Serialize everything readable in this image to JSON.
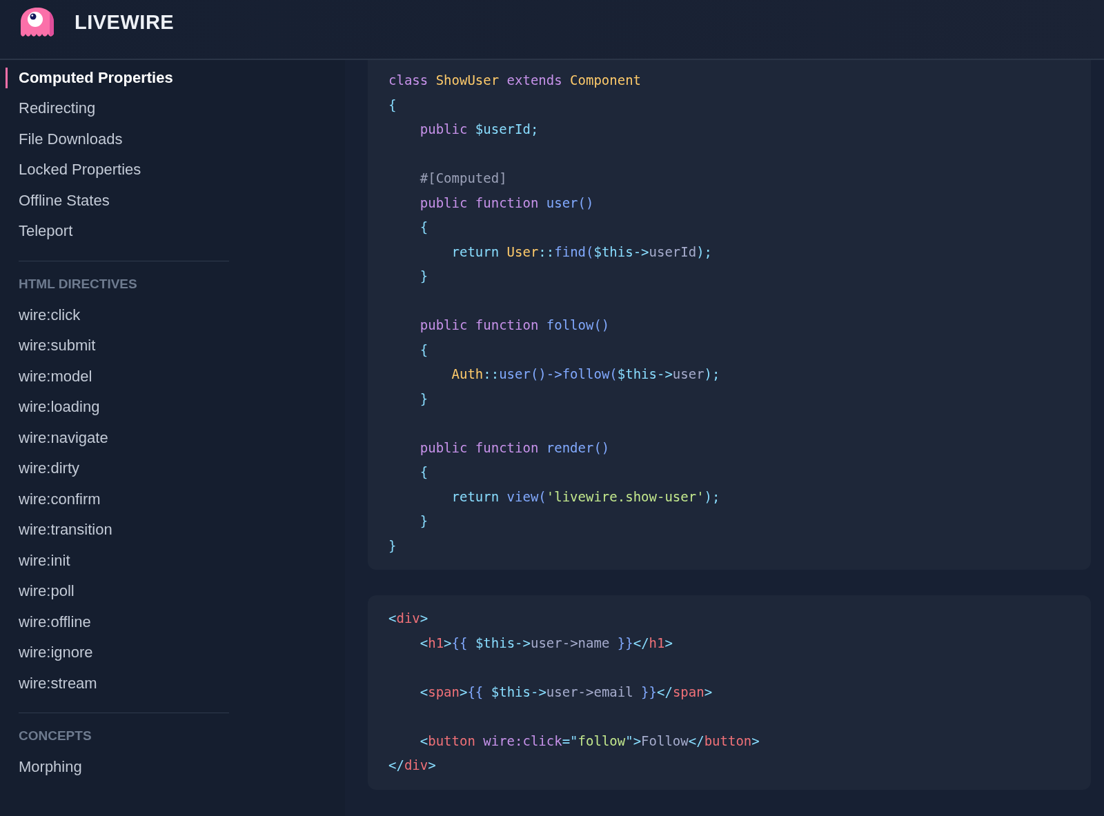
{
  "header": {
    "title": "LIVEWIRE"
  },
  "sidebar": {
    "groups": [
      {
        "items": [
          {
            "label": "Computed Properties",
            "selected": true
          },
          {
            "label": "Redirecting",
            "selected": false
          },
          {
            "label": "File Downloads",
            "selected": false
          },
          {
            "label": "Locked Properties",
            "selected": false
          },
          {
            "label": "Offline States",
            "selected": false
          },
          {
            "label": "Teleport",
            "selected": false
          }
        ]
      },
      {
        "heading": "HTML DIRECTIVES",
        "items": [
          {
            "label": "wire:click",
            "selected": false
          },
          {
            "label": "wire:submit",
            "selected": false
          },
          {
            "label": "wire:model",
            "selected": false
          },
          {
            "label": "wire:loading",
            "selected": false
          },
          {
            "label": "wire:navigate",
            "selected": false
          },
          {
            "label": "wire:dirty",
            "selected": false
          },
          {
            "label": "wire:confirm",
            "selected": false
          },
          {
            "label": "wire:transition",
            "selected": false
          },
          {
            "label": "wire:init",
            "selected": false
          },
          {
            "label": "wire:poll",
            "selected": false
          },
          {
            "label": "wire:offline",
            "selected": false
          },
          {
            "label": "wire:ignore",
            "selected": false
          },
          {
            "label": "wire:stream",
            "selected": false
          }
        ]
      },
      {
        "heading": "CONCEPTS",
        "items": [
          {
            "label": "Morphing",
            "selected": false
          }
        ]
      }
    ]
  },
  "code_blocks": [
    {
      "lines": [
        {
          "kind": "code",
          "tokens": [
            {
              "kind": "keyword",
              "text": "class "
            },
            {
              "kind": "class",
              "text": "ShowUser "
            },
            {
              "kind": "keyword",
              "text": "extends "
            },
            {
              "kind": "class",
              "text": "Component"
            }
          ]
        },
        {
          "kind": "code",
          "tokens": [
            {
              "kind": "punct",
              "text": "{"
            }
          ]
        },
        {
          "kind": "code",
          "tokens": [
            {
              "kind": "keyword",
              "text": "    public "
            },
            {
              "kind": "var",
              "text": "$userId;"
            }
          ]
        },
        {
          "kind": "blank"
        },
        {
          "kind": "code",
          "tokens": [
            {
              "kind": "comment",
              "text": "    #[Computed]"
            }
          ]
        },
        {
          "kind": "code",
          "tokens": [
            {
              "kind": "keyword",
              "text": "    public function "
            },
            {
              "kind": "func",
              "text": "user()"
            }
          ]
        },
        {
          "kind": "code",
          "tokens": [
            {
              "kind": "punct",
              "text": "    {"
            }
          ]
        },
        {
          "kind": "code",
          "tokens": [
            {
              "kind": "punct",
              "text": "        return "
            },
            {
              "kind": "class",
              "text": "User"
            },
            {
              "kind": "punct",
              "text": "::"
            },
            {
              "kind": "func",
              "text": "find("
            },
            {
              "kind": "var",
              "text": "$this->"
            },
            {
              "kind": "plain",
              "text": "userId"
            },
            {
              "kind": "punct",
              "text": ");"
            }
          ]
        },
        {
          "kind": "code",
          "tokens": [
            {
              "kind": "punct",
              "text": "    }"
            }
          ]
        },
        {
          "kind": "blank"
        },
        {
          "kind": "code",
          "tokens": [
            {
              "kind": "keyword",
              "text": "    public function "
            },
            {
              "kind": "func",
              "text": "follow()"
            }
          ]
        },
        {
          "kind": "code",
          "tokens": [
            {
              "kind": "punct",
              "text": "    {"
            }
          ]
        },
        {
          "kind": "code",
          "tokens": [
            {
              "kind": "class",
              "text": "        Auth"
            },
            {
              "kind": "punct",
              "text": "::"
            },
            {
              "kind": "func",
              "text": "user()->follow("
            },
            {
              "kind": "var",
              "text": "$this->"
            },
            {
              "kind": "plain",
              "text": "user"
            },
            {
              "kind": "punct",
              "text": ");"
            }
          ]
        },
        {
          "kind": "code",
          "tokens": [
            {
              "kind": "punct",
              "text": "    }"
            }
          ]
        },
        {
          "kind": "blank"
        },
        {
          "kind": "code",
          "tokens": [
            {
              "kind": "keyword",
              "text": "    public function "
            },
            {
              "kind": "func",
              "text": "render()"
            }
          ]
        },
        {
          "kind": "code",
          "tokens": [
            {
              "kind": "punct",
              "text": "    {"
            }
          ]
        },
        {
          "kind": "code",
          "tokens": [
            {
              "kind": "punct",
              "text": "        return "
            },
            {
              "kind": "func",
              "text": "view("
            },
            {
              "kind": "string",
              "text": "'livewire.show-user'"
            },
            {
              "kind": "punct",
              "text": ");"
            }
          ]
        },
        {
          "kind": "code",
          "tokens": [
            {
              "kind": "punct",
              "text": "    }"
            }
          ]
        },
        {
          "kind": "code",
          "tokens": [
            {
              "kind": "punct",
              "text": "}"
            }
          ]
        }
      ]
    },
    {
      "lines": [
        {
          "kind": "code",
          "tokens": [
            {
              "kind": "punct",
              "text": "<"
            },
            {
              "kind": "tag",
              "text": "div"
            },
            {
              "kind": "punct",
              "text": ">"
            }
          ]
        },
        {
          "kind": "code",
          "tokens": [
            {
              "kind": "punct",
              "text": "    <"
            },
            {
              "kind": "tag",
              "text": "h1"
            },
            {
              "kind": "punct",
              "text": ">"
            },
            {
              "kind": "func",
              "text": "{{ "
            },
            {
              "kind": "var",
              "text": "$this->"
            },
            {
              "kind": "plain",
              "text": "user->name "
            },
            {
              "kind": "func",
              "text": "}}"
            },
            {
              "kind": "punct",
              "text": "</"
            },
            {
              "kind": "tag",
              "text": "h1"
            },
            {
              "kind": "punct",
              "text": ">"
            }
          ]
        },
        {
          "kind": "blank"
        },
        {
          "kind": "code",
          "tokens": [
            {
              "kind": "punct",
              "text": "    <"
            },
            {
              "kind": "tag",
              "text": "span"
            },
            {
              "kind": "punct",
              "text": ">"
            },
            {
              "kind": "func",
              "text": "{{ "
            },
            {
              "kind": "var",
              "text": "$this->"
            },
            {
              "kind": "plain",
              "text": "user->email "
            },
            {
              "kind": "func",
              "text": "}}"
            },
            {
              "kind": "punct",
              "text": "</"
            },
            {
              "kind": "tag",
              "text": "span"
            },
            {
              "kind": "punct",
              "text": ">"
            }
          ]
        },
        {
          "kind": "blank"
        },
        {
          "kind": "code",
          "tokens": [
            {
              "kind": "punct",
              "text": "    <"
            },
            {
              "kind": "tag",
              "text": "button "
            },
            {
              "kind": "attr",
              "text": "wire:click"
            },
            {
              "kind": "punct",
              "text": "=\""
            },
            {
              "kind": "string",
              "text": "follow"
            },
            {
              "kind": "punct",
              "text": "\">"
            },
            {
              "kind": "plain",
              "text": "Follow"
            },
            {
              "kind": "punct",
              "text": "</"
            },
            {
              "kind": "tag",
              "text": "button"
            },
            {
              "kind": "punct",
              "text": ">"
            }
          ]
        },
        {
          "kind": "code",
          "tokens": [
            {
              "kind": "punct",
              "text": "</"
            },
            {
              "kind": "tag",
              "text": "div"
            },
            {
              "kind": "punct",
              "text": ">"
            }
          ]
        }
      ]
    }
  ]
}
